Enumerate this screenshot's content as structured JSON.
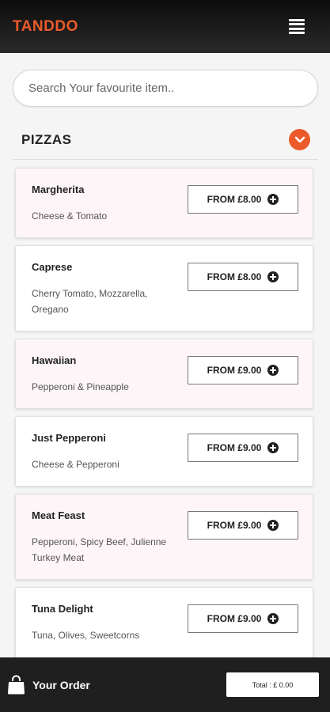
{
  "app": {
    "brand": "TANDDO"
  },
  "search": {
    "placeholder": "Search Your favourite item.."
  },
  "section": {
    "title": "PIZZAS"
  },
  "items": [
    {
      "name": "Margherita",
      "description": "Cheese & Tomato",
      "price_label": "FROM £8.00"
    },
    {
      "name": "Caprese",
      "description": "Cherry Tomato, Mozzarella, Oregano",
      "price_label": "FROM £8.00"
    },
    {
      "name": "Hawaiian",
      "description": "Pepperoni & Pineapple",
      "price_label": "FROM £9.00"
    },
    {
      "name": "Just Pepperoni",
      "description": "Cheese & Pepperoni",
      "price_label": "FROM £9.00"
    },
    {
      "name": "Meat Feast",
      "description": "Pepperoni, Spicy Beef, Julienne Turkey Meat",
      "price_label": "FROM £9.00"
    },
    {
      "name": "Tuna Delight",
      "description": "Tuna, Olives, Sweetcorns",
      "price_label": "FROM £9.00"
    }
  ],
  "footer": {
    "order_label": "Your Order",
    "total_label": "Total : £ 0.00"
  },
  "colors": {
    "accent": "#ec5a2b",
    "header_bg": "#1a1a1a",
    "card_pink": "#fdf5f8"
  },
  "icons": {
    "menu": "hamburger-icon",
    "toggle": "chevron-down-icon",
    "add": "plus-circle-icon",
    "bag": "shopping-bag-icon"
  }
}
